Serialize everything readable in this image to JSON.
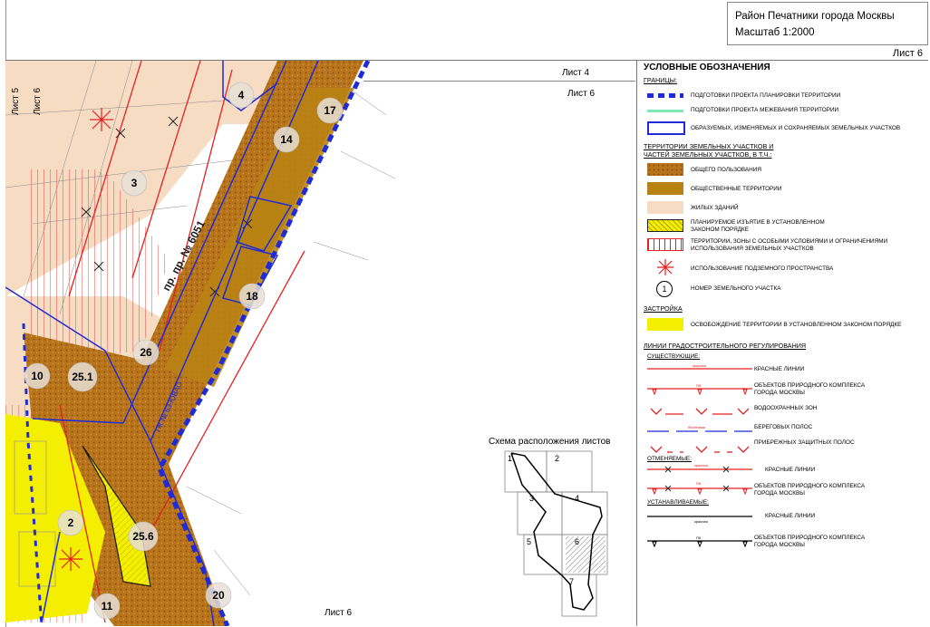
{
  "header": {
    "district": "Район Печатники города Москвы",
    "scale": "Масштаб 1:2000",
    "sheet": "Лист 6"
  },
  "map": {
    "sheet_labels": {
      "top_right_a": "Лист 4",
      "top_right_b": "Лист 6",
      "left_a": "Лист 5",
      "left_b": "Лист 6",
      "bottom": "Лист 6"
    },
    "parcels": [
      "4",
      "17",
      "14",
      "3",
      "18",
      "26",
      "10",
      "25.1",
      "2",
      "25.6",
      "11",
      "20"
    ],
    "road_label": "пр. пр. № 6051",
    "pk_label": "ПК № 63-ЮВАО",
    "small_labels": [
      "6062",
      "кювет",
      "кювет",
      "1:50"
    ]
  },
  "scheme": {
    "title": "Схема расположения листов",
    "cells": [
      "1",
      "2",
      "3",
      "4",
      "5",
      "6",
      "7"
    ]
  },
  "legend": {
    "title": "УСЛОВНЫЕ ОБОЗНАЧЕНИЯ",
    "boundaries_title": "ГРАНИЦЫ:",
    "b1": "ПОДГОТОВКИ ПРОЕКТА ПЛАНИРОВКИ ТЕРРИТОРИИ",
    "b2": "ПОДГОТОВКИ ПРОЕКТА МЕЖЕВАНИЯ ТЕРРИТОРИИ",
    "b3": "ОБРАЗУЕМЫХ, ИЗМЕНЯЕМЫХ И СОХРАНЯЕМЫХ ЗЕМЕЛЬНЫХ УЧАСТКОВ",
    "territories_title_1": "ТЕРРИТОРИИ ЗЕМЕЛЬНЫХ УЧАСТКОВ И",
    "territories_title_2": "ЧАСТЕЙ ЗЕМЕЛЬНЫХ УЧАСТКОВ, В Т.Ч.:",
    "t1": "ОБЩЕГО ПОЛЬЗОВАНИЯ",
    "t2": "ОБЩЕСТВЕННЫЕ ТЕРРИТОРИИ",
    "t3": "ЖИЛЫХ ЗДАНИЙ",
    "t4a": "ПЛАНИРУЕМОЕ ИЗЪЯТИЕ В УСТАНОВЛЕННОМ",
    "t4b": "ЗАКОНОМ ПОРЯДКЕ",
    "t5a": "ТЕРРИТОРИИ, ЗОНЫ С ОСОБЫМИ УСЛОВИЯМИ И ОГРАНИЧЕНИЯМИ",
    "t5b": "ИСПОЛЬЗОВАНИЯ ЗЕМЕЛЬНЫХ УЧАСТКОВ",
    "t6": "ИСПОЛЬЗОВАНИЕ ПОДЗЕМНОГО ПРОСТРАНСТВА",
    "t7": "НОМЕР ЗЕМЕЛЬНОГО УЧАСТКА",
    "t7_sym": "1",
    "build_title": "ЗАСТРОЙКА",
    "bu1": "ОСВОБОЖДЕНИЕ ТЕРРИТОРИИ В УСТАНОВЛЕННОМ ЗАКОНОМ ПОРЯДКЕ",
    "lines_title": "ЛИНИИ ГРАДОСТРОИТЕЛЬНОГО РЕГУЛИРОВАНИЯ",
    "existing": "СУЩЕСТВУЮЩИЕ:",
    "e1": "КРАСНЫЕ ЛИНИИ",
    "e2a": "ОБЪЕКТОВ ПРИРОДНОГО КОМПЛЕКСА",
    "e2b": "ГОРОДА МОСКВЫ",
    "e3": "ВОДООХРАННЫХ ЗОН",
    "e4": "БЕРЕГОВЫХ ПОЛОС",
    "e5": "ПРИБРЕЖНЫХ ЗАЩИТНЫХ ПОЛОС",
    "cancelled": "ОТМЕНЯЕМЫЕ:",
    "c1": "КРАСНЫЕ ЛИНИИ",
    "c2a": "ОБЪЕКТОВ ПРИРОДНОГО КОМПЛЕКСА",
    "c2b": "ГОРОДА МОСКВЫ",
    "established": "УСТАНАВЛИВАЕМЫЕ:",
    "s1": "КРАСНЫЕ ЛИНИИ",
    "s2a": "ОБЪЕКТОВ ПРИРОДНОГО КОМПЛЕКСА",
    "s2b": "ГОРОДА МОСКВЫ",
    "sym_red": "красная",
    "sym_pk": "ПК",
    "sym_coast": "береговая"
  },
  "colors": {
    "public_use": "#b8741a",
    "public_territory": "#b98314",
    "residential": "#f7dcc4",
    "release": "#f4ee00",
    "boundary_blue": "#1f2bd6",
    "red_line": "#e32222",
    "mint": "#7de7b8"
  }
}
